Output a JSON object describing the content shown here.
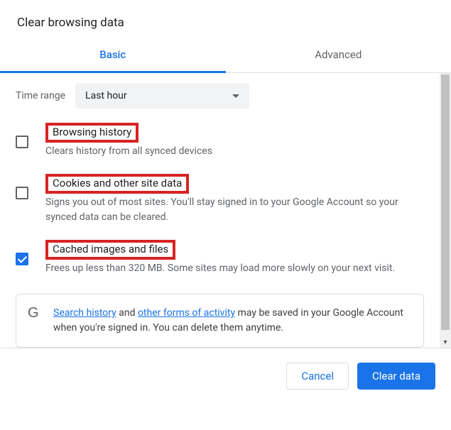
{
  "title": "Clear browsing data",
  "tabs": {
    "basic": "Basic",
    "advanced": "Advanced"
  },
  "range": {
    "label": "Time range",
    "value": "Last hour"
  },
  "items": [
    {
      "title": "Browsing history",
      "desc": "Clears history from all synced devices",
      "checked": false,
      "highlight": true
    },
    {
      "title": "Cookies and other site data",
      "desc": "Signs you out of most sites. You'll stay signed in to your Google Account so your synced data can be cleared.",
      "checked": false,
      "highlight": true
    },
    {
      "title": "Cached images and files",
      "desc_pre": "Frees up less than 320 MB. Some sites may load more slowly on your next visit.",
      "checked": true,
      "highlight": true
    }
  ],
  "info": {
    "link1": "Search history",
    "mid1": " and ",
    "link2": "other forms of activity",
    "tail": " may be saved in your Google Account when you're signed in. You can delete them anytime."
  },
  "buttons": {
    "cancel": "Cancel",
    "clear": "Clear data"
  }
}
